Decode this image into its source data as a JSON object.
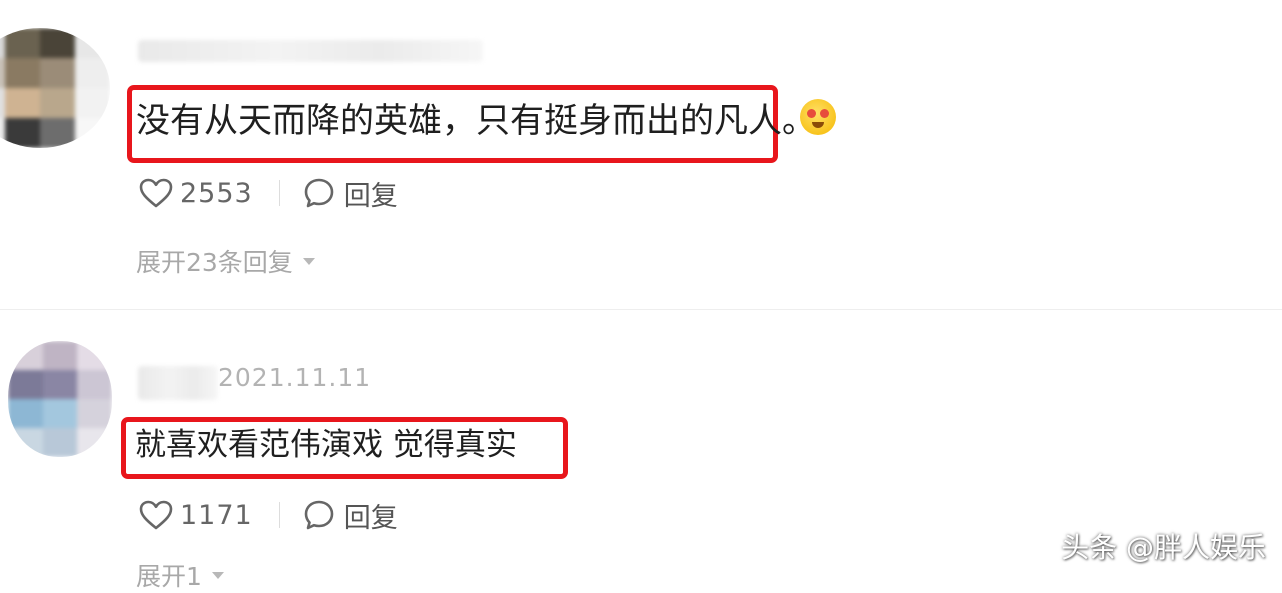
{
  "comments": [
    {
      "avatar_colors": [
        "#d9d9d9",
        "#6a6250",
        "#4a4438",
        "#e7e7e7",
        "#c9c2b8",
        "#8a7a62",
        "#9b8c78",
        "#eeeeee",
        "#e0e0e0",
        "#cfb392",
        "#b9a78c",
        "#f2f2f2",
        "#ededed",
        "#3a3a3a",
        "#6d6d6d",
        "#f7f7f7"
      ],
      "body": "没有从天而降的英雄，只有挺身而出的凡人。",
      "likes": "2553",
      "reply_label": "回复",
      "expand_label": "展开23条回复"
    },
    {
      "date": "2021.11.11",
      "avatar_colors": [
        "#d8d0da",
        "#bfb4c4",
        "#e4dce6",
        "#7c7a98",
        "#8a86a4",
        "#ccc6d4",
        "#8db7d4",
        "#a3c7de",
        "#d5d2dc",
        "#c9d7e2",
        "#b8c8d8",
        "#e8e6ec"
      ],
      "body": "就喜欢看范伟演戏 觉得真实",
      "likes": "1171",
      "reply_label": "回复",
      "expand_label": "展开1"
    }
  ],
  "highlight_color": "#e8161c",
  "watermark": "头条 @胖人娱乐"
}
